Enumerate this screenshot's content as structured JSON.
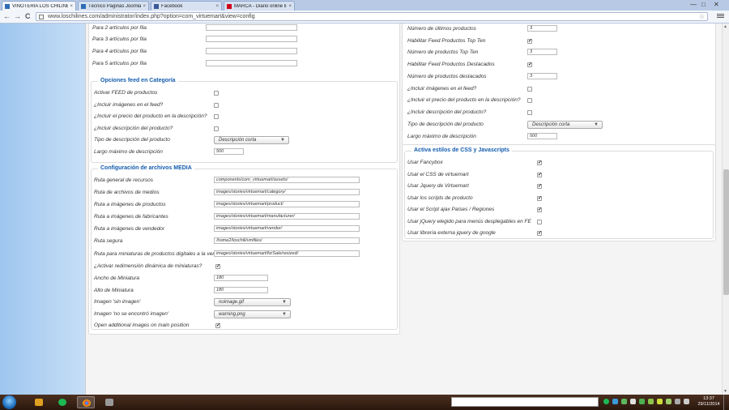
{
  "browser": {
    "tabs": [
      {
        "title": "VINOTERIA LOS CHILINES",
        "active": true,
        "favicon_color": "#2f6db5"
      },
      {
        "title": "Técnico Páginas Joomla",
        "active": false,
        "favicon_color": "#2f6db5"
      },
      {
        "title": "Facebook",
        "active": false,
        "favicon_color": "#3b5998"
      },
      {
        "title": "MARCA - Diario online lí",
        "active": false,
        "favicon_color": "#d0021b"
      }
    ],
    "url": "www.loschilines.com/administrator/index.php?option=com_virtuemart&view=config",
    "close_glyph": "×",
    "window_controls": [
      "—",
      "□",
      "✕"
    ],
    "nav_glyphs": {
      "back": "←",
      "forward": "→",
      "reload": "C"
    },
    "star_glyph": "☆"
  },
  "left": {
    "top_rows": [
      {
        "label": "Para 2 artículos por fila",
        "value": ""
      },
      {
        "label": "Para 3 artículos por fila",
        "value": ""
      },
      {
        "label": "Para 4 artículos por fila",
        "value": ""
      },
      {
        "label": "Para 5 artículos por fila",
        "value": ""
      }
    ],
    "feed_category": {
      "title": "Opciones feed en Categoría",
      "activar": {
        "label": "Activar FEED de productos",
        "checked": false
      },
      "imagenes": {
        "label": "¿Incluir imágenes en el feed?",
        "checked": false
      },
      "precio": {
        "label": "¿Incluir el precio del producto en la descripción?",
        "checked": false
      },
      "descripcion": {
        "label": "¿Incluir descripción del producto?",
        "checked": false
      },
      "tipo": {
        "label": "Tipo de descripción del producto",
        "value": "Descripción corta"
      },
      "largo": {
        "label": "Largo máximo de descripción",
        "value": "500"
      }
    },
    "media": {
      "title": "Configuración de archivos MEDIA",
      "paths": [
        {
          "label": "Ruta general de recursos",
          "value": "components/com_virtuemart/assets/"
        },
        {
          "label": "Ruta de archivos de medios",
          "value": "images/stories/virtuemart/category/"
        },
        {
          "label": "Ruta a imágenes de productos",
          "value": "images/stories/virtuemart/product/"
        },
        {
          "label": "Ruta a imágenes de fabricantes",
          "value": "images/stories/virtuemart/manufacturer/"
        },
        {
          "label": "Ruta a imágenes de vendedor",
          "value": "images/stories/virtuemart/vendor/"
        },
        {
          "label": "Ruta segura",
          "value": "/home2/loschili/vmfiles/"
        },
        {
          "label": "Ruta para miniaturas de productos digitales a la venta",
          "value": "images/stories/virtuemart/forSale/resized/"
        }
      ],
      "redimension": {
        "label": "¿Activar redimensión dinámica de miniaturas?",
        "checked": true
      },
      "ancho": {
        "label": "Ancho de Miniatura",
        "value": "180"
      },
      "alto": {
        "label": "Alto de Miniatura",
        "value": "180"
      },
      "sin_imagen": {
        "label": "Imagen 'sin imagen'",
        "value": "noimage.gif"
      },
      "no_encontro": {
        "label": "Imagen 'no se encontró imagen'",
        "value": "warning.png"
      },
      "additional": {
        "label": "Open additional images on main position",
        "checked": true
      }
    }
  },
  "right": {
    "feed_rows": [
      {
        "kind": "input",
        "label": "Número de últimos productos",
        "value": "3"
      },
      {
        "kind": "check",
        "label": "Habilitar Feed Productos Top Ten",
        "checked": true
      },
      {
        "kind": "input",
        "label": "Número de productos Top Ten",
        "value": "3"
      },
      {
        "kind": "check",
        "label": "Habilitar Feed Productos Destacados",
        "checked": true
      },
      {
        "kind": "input",
        "label": "Número de productos destacados",
        "value": "3"
      },
      {
        "kind": "check",
        "label": "¿Incluir imágenes en el feed?",
        "checked": false
      },
      {
        "kind": "check",
        "label": "¿Incluir el precio del producto en la descripción?",
        "checked": false
      },
      {
        "kind": "check",
        "label": "¿Incluir descripción del producto?",
        "checked": false
      },
      {
        "kind": "select",
        "label": "Tipo de descripción del producto",
        "value": "Descripción corta"
      },
      {
        "kind": "input",
        "label": "Largo máximo de descripción",
        "value": "500"
      }
    ],
    "css_js": {
      "title": "Activa estilos de CSS y Javascripts",
      "rows": [
        {
          "label": "Usar Fancybox",
          "checked": true
        },
        {
          "label": "Usar el CSS de virtuemart",
          "checked": true
        },
        {
          "label": "Usar Jquery de Virtuemart",
          "checked": true
        },
        {
          "label": "Usar los scripts de producto",
          "checked": true
        },
        {
          "label": "Usar el Script ajax Países / Regiones",
          "checked": true
        },
        {
          "label": "Usar jQuery elegido para menús desplegables en FE",
          "checked": false
        },
        {
          "label": "Usar librería externa jquery de google",
          "checked": true
        }
      ]
    }
  },
  "taskbar": {
    "time": "13:37",
    "date": "29/11/2014"
  },
  "colors": {
    "legend": "#135cae",
    "sidebar": "#9ec6ef"
  }
}
